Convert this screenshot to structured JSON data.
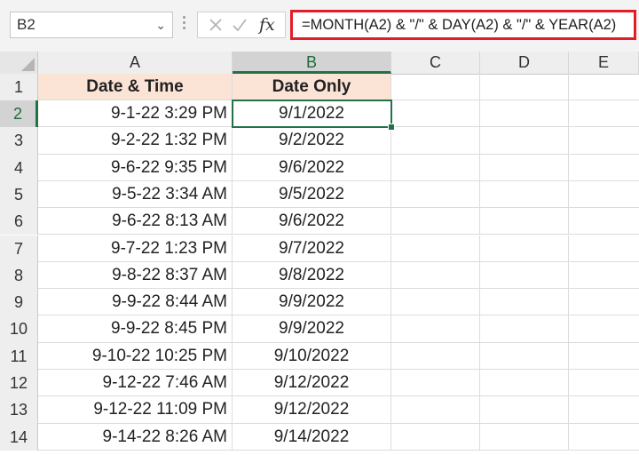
{
  "name_box": {
    "value": "B2",
    "caret_icon": "chevron-down-icon"
  },
  "formula_bar": {
    "cancel_icon": "cancel-x-icon",
    "enter_icon": "checkmark-icon",
    "function_label": "fx",
    "formula": "=MONTH(A2) & \"/\" & DAY(A2) & \"/\" & YEAR(A2)",
    "highlight_color": "#e11d2a"
  },
  "columns": [
    "A",
    "B",
    "C",
    "D",
    "E"
  ],
  "selected_cell": "B2",
  "header_row": {
    "row": "1",
    "a": "Date & Time",
    "b": "Date Only",
    "fill_color": "#fbe4d6"
  },
  "rows": [
    {
      "row": "2",
      "a": "9-1-22 3:29 PM",
      "b": "9/1/2022"
    },
    {
      "row": "3",
      "a": "9-2-22 1:32 PM",
      "b": "9/2/2022"
    },
    {
      "row": "4",
      "a": "9-6-22 9:35 PM",
      "b": "9/6/2022"
    },
    {
      "row": "5",
      "a": "9-5-22 3:34 AM",
      "b": "9/5/2022"
    },
    {
      "row": "6",
      "a": "9-6-22 8:13 AM",
      "b": "9/6/2022"
    },
    {
      "row": "7",
      "a": "9-7-22 1:23 PM",
      "b": "9/7/2022"
    },
    {
      "row": "8",
      "a": "9-8-22 8:37 AM",
      "b": "9/8/2022"
    },
    {
      "row": "9",
      "a": "9-9-22 8:44 AM",
      "b": "9/9/2022"
    },
    {
      "row": "10",
      "a": "9-9-22 8:45 PM",
      "b": "9/9/2022"
    },
    {
      "row": "11",
      "a": "9-10-22 10:25 PM",
      "b": "9/10/2022"
    },
    {
      "row": "12",
      "a": "9-12-22 7:46 AM",
      "b": "9/12/2022"
    },
    {
      "row": "13",
      "a": "9-12-22 11:09 PM",
      "b": "9/12/2022"
    },
    {
      "row": "14",
      "a": "9-14-22 8:26 AM",
      "b": "9/14/2022"
    }
  ],
  "accent_color": "#217346"
}
